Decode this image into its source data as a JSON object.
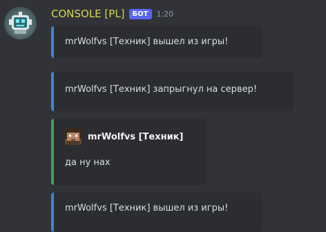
{
  "message": {
    "author": "CONSOLE [PL]",
    "badge": "БОТ",
    "time": "1:20",
    "author_color": "#d7d54f"
  },
  "embeds": [
    {
      "text": "mrWolfvs [Техник] вышел из игры!",
      "color": "#3b87d6"
    },
    {
      "text": "mrWolfvs [Техник] запрыгнул на сервер!",
      "color": "#3b87d6"
    },
    {
      "author": "mrWolfvs [Техник]",
      "description": "да ну нах",
      "color": "#3ba55c"
    },
    {
      "text": "mrWolfvs [Техник] вышел из игры!",
      "color": "#3b87d6"
    }
  ],
  "colors": {
    "background": "#313338",
    "embed_bg": "#2b2d31",
    "badge": "#5865f2",
    "text": "#dbdee1",
    "timestamp": "#949ba4"
  },
  "icons": {
    "bot_avatar": "pixel-robot-avatar",
    "player_avatar": "minecraft-head-avatar"
  }
}
